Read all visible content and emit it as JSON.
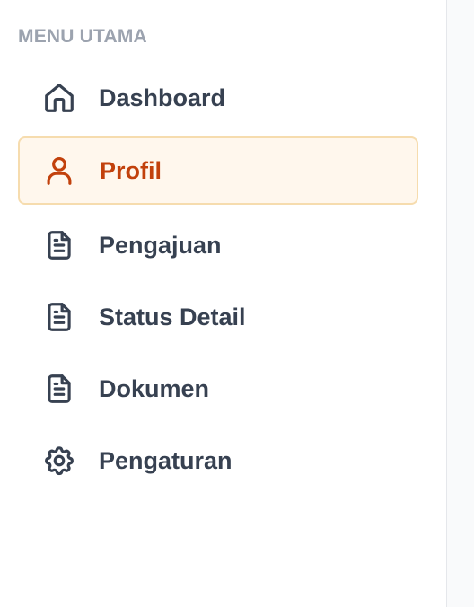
{
  "sidebar": {
    "section_title": "MENU UTAMA",
    "items": [
      {
        "label": "Dashboard",
        "icon": "home-icon",
        "active": false
      },
      {
        "label": "Profil",
        "icon": "user-icon",
        "active": true
      },
      {
        "label": "Pengajuan",
        "icon": "document-icon",
        "active": false
      },
      {
        "label": "Status Detail",
        "icon": "document-icon",
        "active": false
      },
      {
        "label": "Dokumen",
        "icon": "document-icon",
        "active": false
      },
      {
        "label": "Pengaturan",
        "icon": "gear-icon",
        "active": false
      }
    ]
  },
  "colors": {
    "active_text": "#c2410c",
    "active_bg": "#fff7ed",
    "active_border": "#f6dcae",
    "text": "#374151",
    "section_label": "#9ca3af"
  }
}
